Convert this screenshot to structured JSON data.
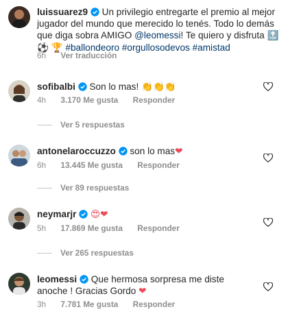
{
  "post": {
    "username": "luissuarez9",
    "caption_part1": "Un privilegio entregarte el premio al mejor jugador del mundo que merecido lo tenés. Todo lo demás que diga sobra AMIGO",
    "mention": "@leomessi",
    "caption_part2": "! Te quiero y disfruta",
    "emoji_top": "🔝",
    "emoji_ball": "⚽",
    "emoji_trophy": "🏆",
    "hashtags": "#ballondeoro #orgullosodevos #amistad",
    "time": "6h",
    "translate_label": "Ver traducción"
  },
  "comments": [
    {
      "username": "sofibalbi",
      "text": "Son lo mas!",
      "emoji": "👏👏👏",
      "time": "4h",
      "likes": "3.170 Me gusta",
      "reply_label": "Responder",
      "view_replies": "Ver 5 respuestas"
    },
    {
      "username": "antonelaroccuzzo",
      "text": "son lo mas",
      "emoji": "❤",
      "time": "6h",
      "likes": "13.445 Me gusta",
      "reply_label": "Responder",
      "view_replies": "Ver 89 respuestas"
    },
    {
      "username": "neymarjr",
      "text": "",
      "emoji": "😍❤",
      "time": "5h",
      "likes": "17.869 Me gusta",
      "reply_label": "Responder",
      "view_replies": "Ver 265 respuestas"
    },
    {
      "username": "leomessi",
      "text": "Que hermosa sorpresa me diste anoche ! Gracias Gordo",
      "emoji": "❤",
      "time": "3h",
      "likes": "7.781 Me gusta",
      "reply_label": "Responder"
    }
  ],
  "colors": {
    "text": "#262626",
    "secondary": "#8e8e8e",
    "link": "#00376b",
    "verified": "#0095f6",
    "heart_red": "#ed4956"
  }
}
